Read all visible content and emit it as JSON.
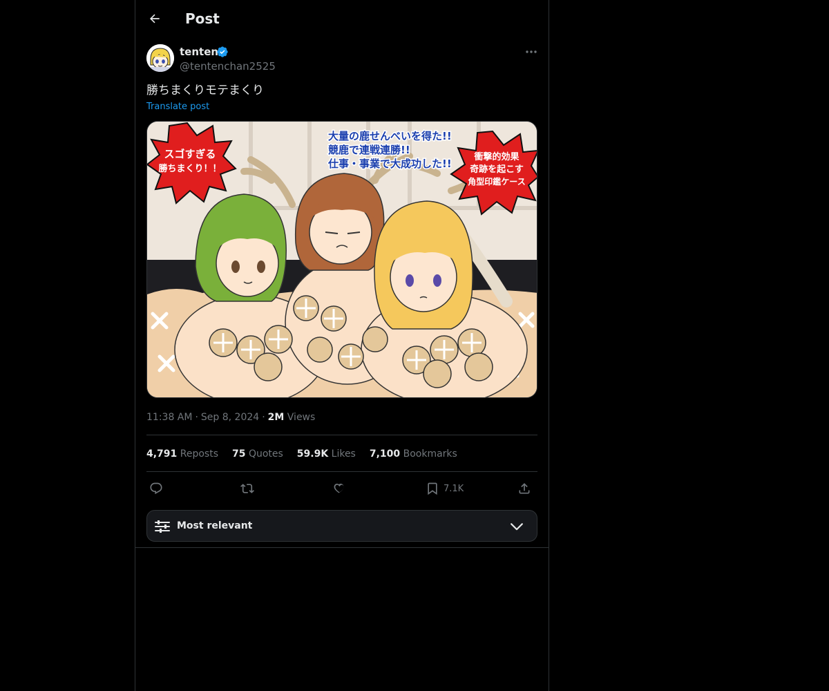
{
  "header": {
    "title": "Post"
  },
  "author": {
    "display_name": "tenten",
    "handle": "@tentenchan2525",
    "verified": true
  },
  "post": {
    "text": "勝ちまくりモテまくり",
    "translate_label": "Translate post",
    "image_texts": {
      "burst_left": [
        "スゴすぎる",
        "勝ちまくり！！"
      ],
      "center": [
        "大量の鹿せんべいを得た!!",
        "競鹿で連戦連勝!!",
        "仕事・事業で大成功した!!"
      ],
      "burst_right": [
        "衝撃的効果",
        "奇跡を起こす",
        "角型印鑑ケース"
      ]
    }
  },
  "meta": {
    "time": "11:38 AM",
    "date": "Sep 8, 2024",
    "views_count": "2M",
    "views_label": "Views"
  },
  "stats": [
    {
      "count": "4,791",
      "label": "Reposts"
    },
    {
      "count": "75",
      "label": "Quotes"
    },
    {
      "count": "59.9K",
      "label": "Likes"
    },
    {
      "count": "7,100",
      "label": "Bookmarks"
    }
  ],
  "actions": {
    "bookmark_count": "7.1K"
  },
  "sort": {
    "label": "Most relevant"
  },
  "colors": {
    "accent": "#1d9bf0",
    "background": "#000000",
    "border": "#2f3336",
    "muted": "#71767b",
    "text": "#e7e9ea"
  }
}
